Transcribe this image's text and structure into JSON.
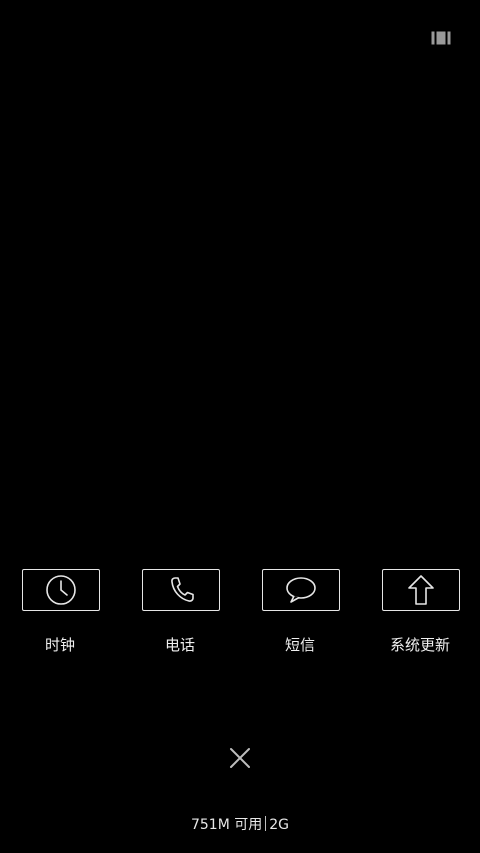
{
  "toolbar": {
    "layout_toggle_icon": "grid-view-icon"
  },
  "apps": [
    {
      "label": "时钟",
      "icon": "clock-icon"
    },
    {
      "label": "电话",
      "icon": "phone-icon"
    },
    {
      "label": "短信",
      "icon": "message-bubble-icon"
    },
    {
      "label": "系统更新",
      "icon": "arrow-up-icon"
    }
  ],
  "footer": {
    "close_icon": "close-icon",
    "memory_free": "751M 可用",
    "memory_total": "2G"
  },
  "colors": {
    "background": "#000000",
    "foreground": "#e6e6e6"
  }
}
